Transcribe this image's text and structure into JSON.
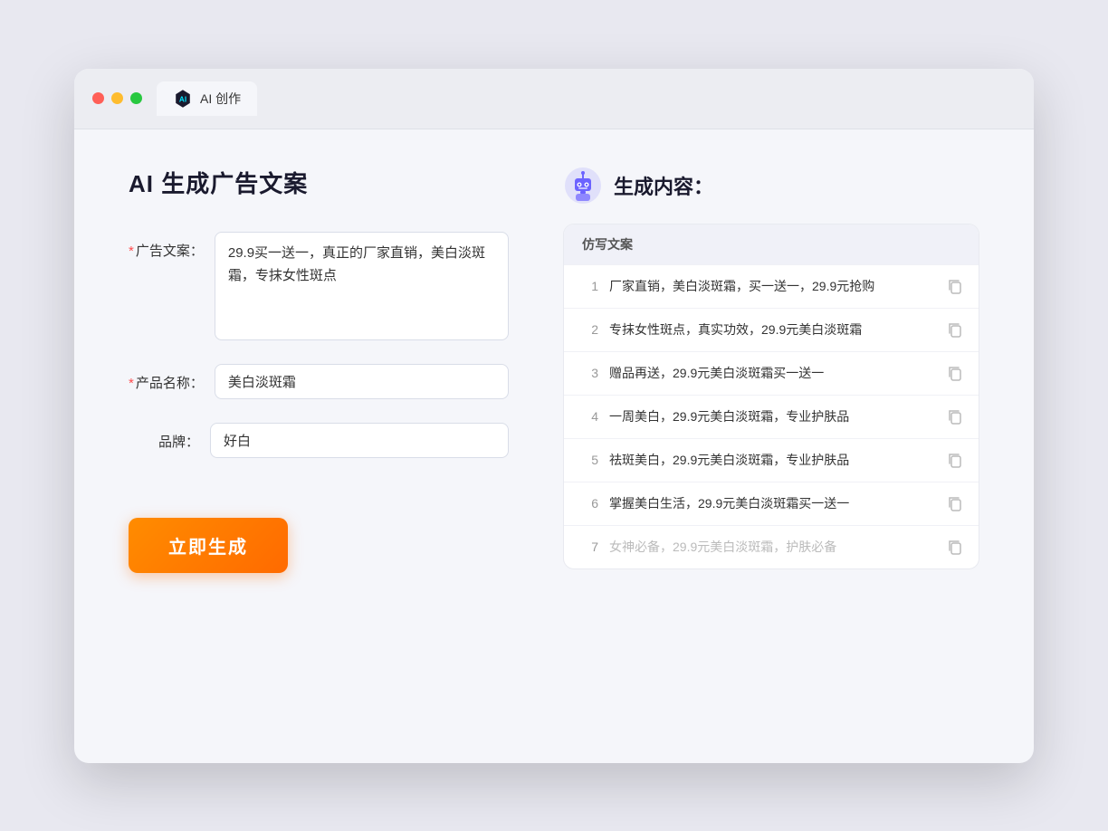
{
  "window": {
    "tab_label": "AI 创作"
  },
  "page": {
    "title": "AI 生成广告文案",
    "right_title": "生成内容："
  },
  "form": {
    "ad_copy_label": "广告文案：",
    "ad_copy_required": "*",
    "ad_copy_value": "29.9买一送一，真正的厂家直销，美白淡斑霜，专抹女性斑点",
    "product_name_label": "产品名称：",
    "product_name_required": "*",
    "product_name_value": "美白淡斑霜",
    "brand_label": "品牌：",
    "brand_value": "好白",
    "generate_button": "立即生成"
  },
  "results": {
    "column_header": "仿写文案",
    "items": [
      {
        "id": 1,
        "text": "厂家直销，美白淡斑霜，买一送一，29.9元抢购",
        "dimmed": false
      },
      {
        "id": 2,
        "text": "专抹女性斑点，真实功效，29.9元美白淡斑霜",
        "dimmed": false
      },
      {
        "id": 3,
        "text": "赠品再送，29.9元美白淡斑霜买一送一",
        "dimmed": false
      },
      {
        "id": 4,
        "text": "一周美白，29.9元美白淡斑霜，专业护肤品",
        "dimmed": false
      },
      {
        "id": 5,
        "text": "祛斑美白，29.9元美白淡斑霜，专业护肤品",
        "dimmed": false
      },
      {
        "id": 6,
        "text": "掌握美白生活，29.9元美白淡斑霜买一送一",
        "dimmed": false
      },
      {
        "id": 7,
        "text": "女神必备，29.9元美白淡斑霜，护肤必备",
        "dimmed": true
      }
    ]
  }
}
